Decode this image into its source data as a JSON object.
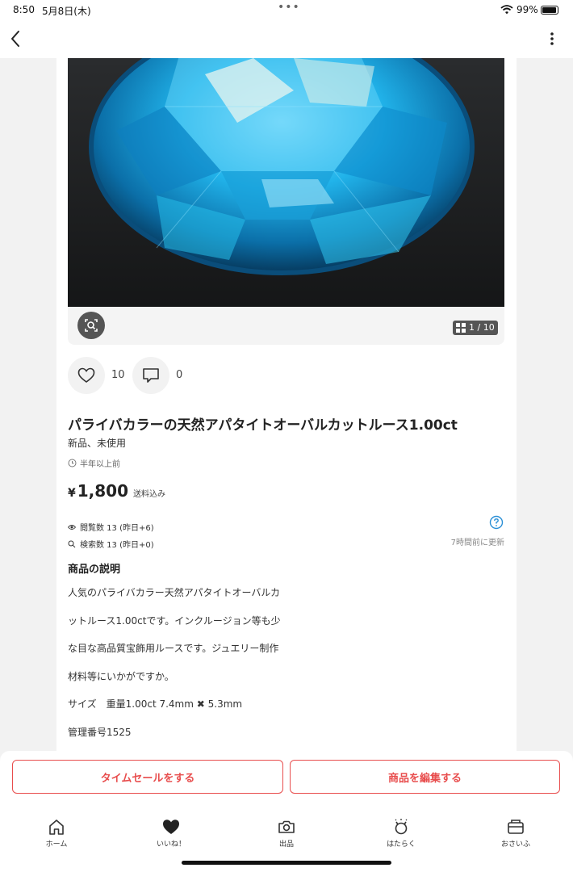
{
  "status_bar": {
    "time": "8:50",
    "date": "5月8日(木)",
    "dots": "•••",
    "battery": "99%"
  },
  "photo": {
    "page_indicator": "1 / 10",
    "current_page": 1,
    "total_pages": 10
  },
  "actions": {
    "likes_count": "10",
    "comments_count": "0"
  },
  "item": {
    "title": "パライバカラーの天然アパタイトオーバルカットルース1.00ct",
    "condition": "新品、未使用",
    "posted": "半年以上前",
    "price_symbol": "¥",
    "price": "1,800",
    "shipping": "送料込み"
  },
  "stats": {
    "views": "閲覧数 13 (昨日+6)",
    "searches": "検索数 13 (昨日+0)",
    "updated": "7時間前に更新"
  },
  "description": {
    "heading": "商品の説明",
    "lines": [
      "人気のパライバカラー天然アパタイトオーバルカ",
      "ットルース1.00ctです。インクルージョン等も少",
      "な目な高品質宝飾用ルースです。ジュエリー制作",
      "材料等にいかがですか。",
      "サイズ　重量1.00ct 7.4mm ✖ 5.3mm",
      "管理番号1525"
    ]
  },
  "buttons": {
    "time_sale": "タイムセールをする",
    "edit_item": "商品を編集する"
  },
  "tabs": [
    {
      "label": "ホーム",
      "icon": "home-icon"
    },
    {
      "label": "いいね！",
      "icon": "heart-icon"
    },
    {
      "label": "出品",
      "icon": "camera-icon"
    },
    {
      "label": "はたらく",
      "icon": "work-icon"
    },
    {
      "label": "おさいふ",
      "icon": "wallet-icon"
    }
  ],
  "colors": {
    "accent_red": "#e84d4d",
    "gem_blue": "#1fb0e6",
    "help_blue": "#2a8fd6"
  }
}
